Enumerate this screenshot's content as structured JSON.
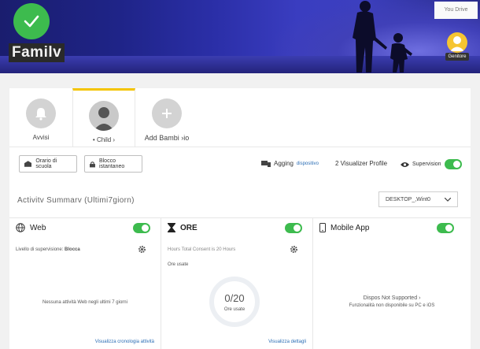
{
  "header": {
    "family_name": "Familv",
    "top_right_button": "You Drive",
    "parent_label": "Genitore"
  },
  "profiles": [
    {
      "label": "Avvisi"
    },
    {
      "label": "• Child ›"
    },
    {
      "label": "Add Bambi ›io"
    }
  ],
  "toolbar": {
    "school_hours": "Orario di scuola",
    "instant_block": "Blocco istantaneo",
    "adding_label": "Agging",
    "adding_link": "dispositivo",
    "view_profile": "2 Visualizer Profile",
    "supervision": "Supervision"
  },
  "summary": {
    "title": "Activitv Summarv (Ultimi7giorn)",
    "device": "DESKTOP_,Wint0"
  },
  "cards": {
    "web": {
      "title": "Web",
      "level_label": "Livello di supervisione:",
      "level_value": "Blocca",
      "empty_text": "Nessuna attività Web negli ultimi 7 giorni",
      "link": "Visualizza cronologia attività"
    },
    "hours": {
      "title": "ORE",
      "sub": "Hours Total Consent is 20 Hours",
      "used_label": "Ore usate",
      "ring_value": "0/20",
      "ring_sub": "Ore usate",
      "link": "Visualizza dettagli"
    },
    "mobile": {
      "title": "Mobile App",
      "status_prefix": "Dispos",
      "status": "Not Supported",
      "status_suffix": "›",
      "note": "Funzionalità non disponibile su PC e iOS"
    }
  },
  "colors": {
    "accent_green": "#3dbb4e",
    "tab_highlight": "#f4c400",
    "link_blue": "#2a6db5"
  }
}
